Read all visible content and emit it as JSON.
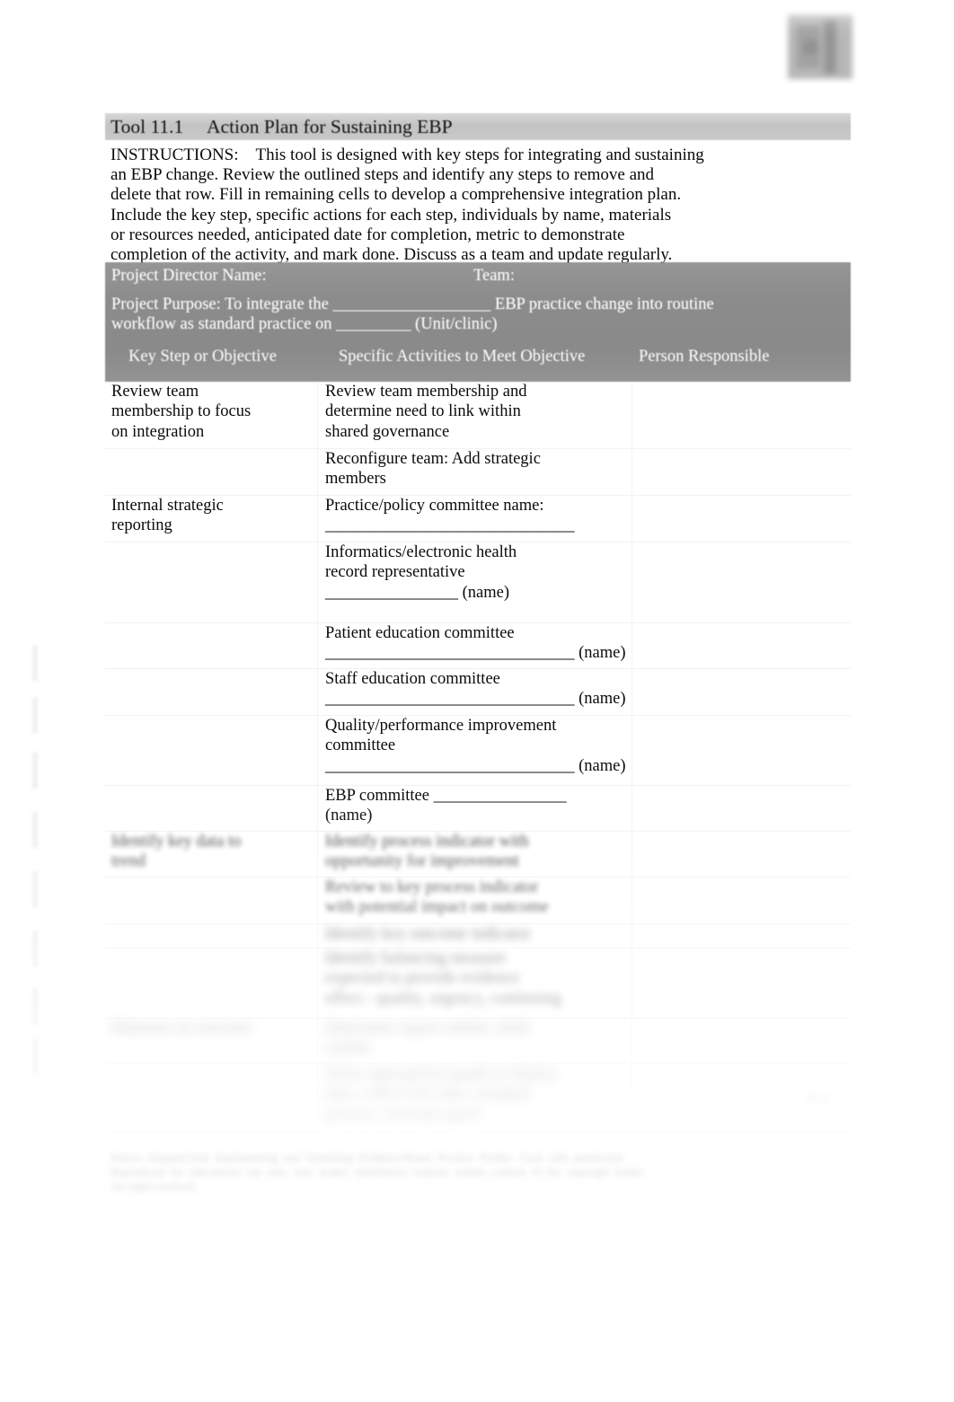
{
  "document": {
    "title_number": "Tool 11.1",
    "title_text": "Action Plan for Sustaining EBP",
    "title_full": "Tool 11.1  Action Plan for Sustaining EBP",
    "background_color": "#ffffff",
    "title_bar_color": "#c6c6c6",
    "header_block_color": "#8c8c8c",
    "header_text_color": "#ffffff",
    "body_text_color": "#000000"
  },
  "instructions": {
    "label": "INSTRUCTIONS:",
    "lines": [
      "INSTRUCTIONS: This tool is designed with key steps for integrating and sustaining",
      "an EBP change. Review the outlined steps and identify any steps to remove and",
      "delete that row. Fill in remaining cells to develop a comprehensive integration plan.",
      "Include the key step, specific actions for each step, individuals by name, materials",
      "or resources needed, anticipated date for completion, metric to demonstrate",
      "completion of the activity, and mark done. Discuss as a team and update regularly."
    ]
  },
  "form_header": {
    "director_label": "Project Director Name:",
    "team_label": "Team:",
    "purpose_line_1": "Project Purpose: To integrate the ___________________ EBP practice change into routine",
    "purpose_line_2": "workflow as standard practice on _________ (Unit/clinic)"
  },
  "table": {
    "columns": [
      "Key Step or Objective",
      "Specific Activities to Meet Objective",
      "Person Responsible"
    ],
    "rows": [
      {
        "key_step": [
          "Review team",
          "membership to focus",
          "on integration"
        ],
        "activities": [
          "Review team membership and",
          "determine need to link within",
          "shared governance"
        ],
        "person": [],
        "blur": "none"
      },
      {
        "key_step": [],
        "activities": [
          "Reconfigure team: Add strategic",
          "members"
        ],
        "person": [],
        "blur": "none"
      },
      {
        "key_step": [
          "Internal strategic",
          "reporting"
        ],
        "activities": [
          "Practice/policy committee name:",
          "______________________________"
        ],
        "person": [],
        "blur": "none"
      },
      {
        "key_step": [],
        "activities": [
          "Informatics/electronic health",
          "record representative",
          "________________ (name)"
        ],
        "person": [],
        "blur": "none"
      },
      {
        "key_step": [],
        "activities": [
          "Patient education committee",
          "______________________________ (name)"
        ],
        "person": [],
        "blur": "none"
      },
      {
        "key_step": [],
        "activities": [
          "Staff education committee",
          "______________________________ (name)"
        ],
        "person": [],
        "blur": "none"
      },
      {
        "key_step": [],
        "activities": [
          "Quality/performance improvement",
          "committee",
          "______________________________ (name)"
        ],
        "person": [],
        "blur": "none"
      },
      {
        "key_step": [],
        "activities": [
          "EBP committee ________________",
          "(name)"
        ],
        "person": [],
        "blur": "none"
      },
      {
        "key_step": [
          "Identify key data to",
          "trend"
        ],
        "activities": [
          "Identify process indicator with",
          "opportunity for improvement"
        ],
        "person": [],
        "blur": "light"
      },
      {
        "key_step": [],
        "activities": [
          "Review to key process indicator",
          "with potential impact on outcome"
        ],
        "person": [],
        "blur": "light"
      },
      {
        "key_step": [],
        "activities": [
          "Identify key outcome indicator"
        ],
        "person": [],
        "blur": "medium"
      },
      {
        "key_step": [],
        "activities": [
          "Identify balancing measure",
          "expected to provide evidence",
          "effect - quality, urgency, continuing"
        ],
        "person": [],
        "blur": "medium"
      },
      {
        "key_step": [
          "Maintain an outcome"
        ],
        "activities": [
          "Determine report outline, draft",
          "outline"
        ],
        "person": [],
        "blur": "heavy"
      },
      {
        "key_step": [],
        "activities": [
          "Select appropriate graph or display",
          "data, collect key data, standard",
          "process, relevant report"
        ],
        "person": [],
        "blur": "heavy"
      }
    ]
  },
  "footer": {
    "lines": [
      "Source: Adapted from  Implementing  and  Sustaining  Evidence-Based  Practice  Toolkit.  Used  with  permission.",
      "Reproduced  for  educational  use  only.  Any  further  distribution  requires  written  consent  of  the  copyright  holder.",
      "All rights reserved."
    ],
    "page_number": "11-1"
  },
  "decor": {
    "logo": "institution-logo",
    "margin_marks": "scan-edge-marks"
  }
}
